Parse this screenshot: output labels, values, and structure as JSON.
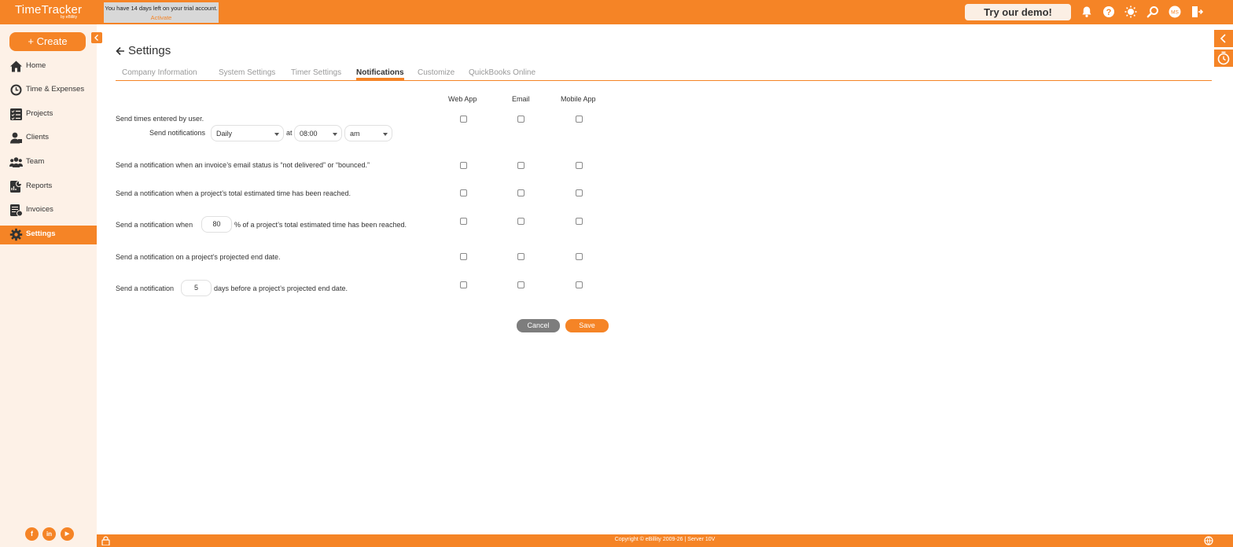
{
  "app": {
    "logo_title": "TimeTracker",
    "logo_sub": "by eBillity",
    "trial_text": "You have 14 days left on your trial account.",
    "trial_link": "Activate",
    "demo_button": "Try our demo!",
    "user_initials": "MS"
  },
  "colors": {
    "accent": "#f58426",
    "sidebar_bg": "#fdf1e7",
    "cancel": "#7d7d7d"
  },
  "sidebar": {
    "create_label": "+ Create",
    "items": [
      {
        "label": "Home",
        "icon": "home-icon"
      },
      {
        "label": "Time & Expenses",
        "icon": "clock-icon"
      },
      {
        "label": "Projects",
        "icon": "checklist-icon"
      },
      {
        "label": "Clients",
        "icon": "client-icon"
      },
      {
        "label": "Team",
        "icon": "team-icon"
      },
      {
        "label": "Reports",
        "icon": "report-icon"
      },
      {
        "label": "Invoices",
        "icon": "invoice-icon"
      },
      {
        "label": "Settings",
        "icon": "gear-icon",
        "active": true
      }
    ],
    "social": {
      "facebook": "f",
      "linkedin": "in",
      "youtube": "▶"
    }
  },
  "page": {
    "title": "Settings",
    "tabs": [
      "Company Information",
      "System Settings",
      "Timer Settings",
      "Notifications",
      "Customize",
      "QuickBooks Online"
    ],
    "active_tab": "Notifications"
  },
  "columns": [
    "Web App",
    "Email",
    "Mobile App"
  ],
  "rows": {
    "send_times": "Send times entered by user.",
    "send_notifications_label": "Send notifications",
    "frequency": "Daily",
    "at": "at",
    "time": "08:00",
    "ampm": "am",
    "invoice_status": "Send a notification when an invoice’s email status is “not delivered” or “bounced.”",
    "total_reached": "Send a notification when a project’s total estimated time has been reached.",
    "percent_prefix": "Send a notification when",
    "percent_value": "80",
    "percent_suffix": "% of a project’s total estimated time has been reached.",
    "end_date": "Send a notification on a project’s projected end date.",
    "days_prefix": "Send a notification",
    "days_value": "5",
    "days_suffix": "days before a project’s projected end date."
  },
  "buttons": {
    "cancel": "Cancel",
    "save": "Save"
  },
  "footer": {
    "copyright": "Copyright © eBillity 2009-26 | Server 10V"
  }
}
